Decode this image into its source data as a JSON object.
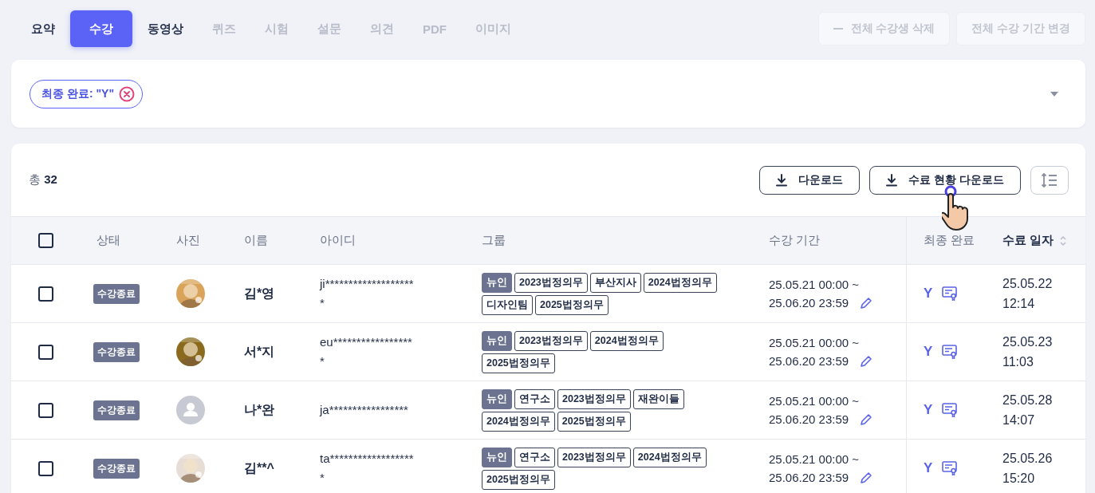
{
  "tabs": [
    {
      "label": "요약",
      "selected": false,
      "disabled": false
    },
    {
      "label": "수강",
      "selected": true,
      "disabled": false
    },
    {
      "label": "동영상",
      "selected": false,
      "disabled": false
    },
    {
      "label": "퀴즈",
      "selected": false,
      "disabled": true
    },
    {
      "label": "시험",
      "selected": false,
      "disabled": true
    },
    {
      "label": "설문",
      "selected": false,
      "disabled": true
    },
    {
      "label": "의견",
      "selected": false,
      "disabled": true
    },
    {
      "label": "PDF",
      "selected": false,
      "disabled": true
    },
    {
      "label": "이미지",
      "selected": false,
      "disabled": true
    }
  ],
  "top_actions": [
    {
      "label": "전체 수강생 삭제",
      "kind": "with_icon",
      "disabled": true
    },
    {
      "label": "전체 수강 기간 변경",
      "kind": "plain",
      "disabled": true
    }
  ],
  "filter": {
    "chips": [
      "최종 완료: \"Y\""
    ]
  },
  "toolbar": {
    "total": "총 **32**",
    "buttons": [
      {
        "label": "다운로드"
      },
      {
        "label": "수료 현황 다운로드"
      }
    ]
  },
  "table": {
    "header_checked": false,
    "columns": [
      {
        "label": "상태",
        "sortable": false
      },
      {
        "label": "사진",
        "sortable": false
      },
      {
        "label": "이름",
        "sortable": false
      },
      {
        "label": "아이디",
        "sortable": false
      },
      {
        "label": "그룹",
        "sortable": false
      },
      {
        "label": "수강 기간",
        "sortable": false
      },
      {
        "label": "최종 완료",
        "sortable": false
      },
      {
        "label": "수료 일자",
        "sortable": true
      }
    ],
    "rows": [
      {
        "checked": false,
        "status": "수강종료",
        "photo": {
          "kind": "picture",
          "color": "#d9a35a"
        },
        "name": "김*영",
        "id": "ji********************",
        "groups": [
          {
            "label": "뉴인",
            "kind": "filled"
          },
          {
            "label": "2023법정의무",
            "kind": "outline"
          },
          {
            "label": "부산지사",
            "kind": "outline"
          },
          {
            "label": "2024법정의무",
            "kind": "outline"
          },
          {
            "label": "디자인팀",
            "kind": "outline"
          },
          {
            "label": "2025법정의무",
            "kind": "outline"
          }
        ],
        "period_start": "25.05.21 00:00 ~",
        "period_end": "25.06.20 23:59",
        "final": "Y",
        "completed": "25.05.22 12:14"
      },
      {
        "checked": false,
        "status": "수강종료",
        "photo": {
          "kind": "picture",
          "color": "#8a6a1c"
        },
        "name": "서*지",
        "id": "eu******************",
        "groups": [
          {
            "label": "뉴인",
            "kind": "filled"
          },
          {
            "label": "2023법정의무",
            "kind": "outline"
          },
          {
            "label": "2024법정의무",
            "kind": "outline"
          },
          {
            "label": "2025법정의무",
            "kind": "outline"
          }
        ],
        "period_start": "25.05.21 00:00 ~",
        "period_end": "25.06.20 23:59",
        "final": "Y",
        "completed": "25.05.23 11:03"
      },
      {
        "checked": false,
        "status": "수강종료",
        "photo": {
          "kind": "default",
          "color": "#c8cad3"
        },
        "name": "나*완",
        "id": "ja*****************",
        "groups": [
          {
            "label": "뉴인",
            "kind": "filled"
          },
          {
            "label": "연구소",
            "kind": "outline"
          },
          {
            "label": "2023법정의무",
            "kind": "outline"
          },
          {
            "label": "재완이들",
            "kind": "outline"
          },
          {
            "label": "2024법정의무",
            "kind": "outline"
          },
          {
            "label": "2025법정의무",
            "kind": "outline"
          }
        ],
        "period_start": "25.05.21 00:00 ~",
        "period_end": "25.06.20 23:59",
        "final": "Y",
        "completed": "25.05.28 14:07"
      },
      {
        "checked": false,
        "status": "수강종료",
        "photo": {
          "kind": "picture",
          "color": "#e8ddd4"
        },
        "name": "김**^",
        "id": "ta*******************",
        "groups": [
          {
            "label": "뉴인",
            "kind": "filled"
          },
          {
            "label": "연구소",
            "kind": "outline"
          },
          {
            "label": "2023법정의무",
            "kind": "outline"
          },
          {
            "label": "2024법정의무",
            "kind": "outline"
          },
          {
            "label": "2025법정의무",
            "kind": "outline"
          }
        ],
        "period_start": "25.05.21 00:00 ~",
        "period_end": "25.06.20 23:59",
        "final": "Y",
        "completed": "25.05.26 15:20"
      }
    ]
  }
}
